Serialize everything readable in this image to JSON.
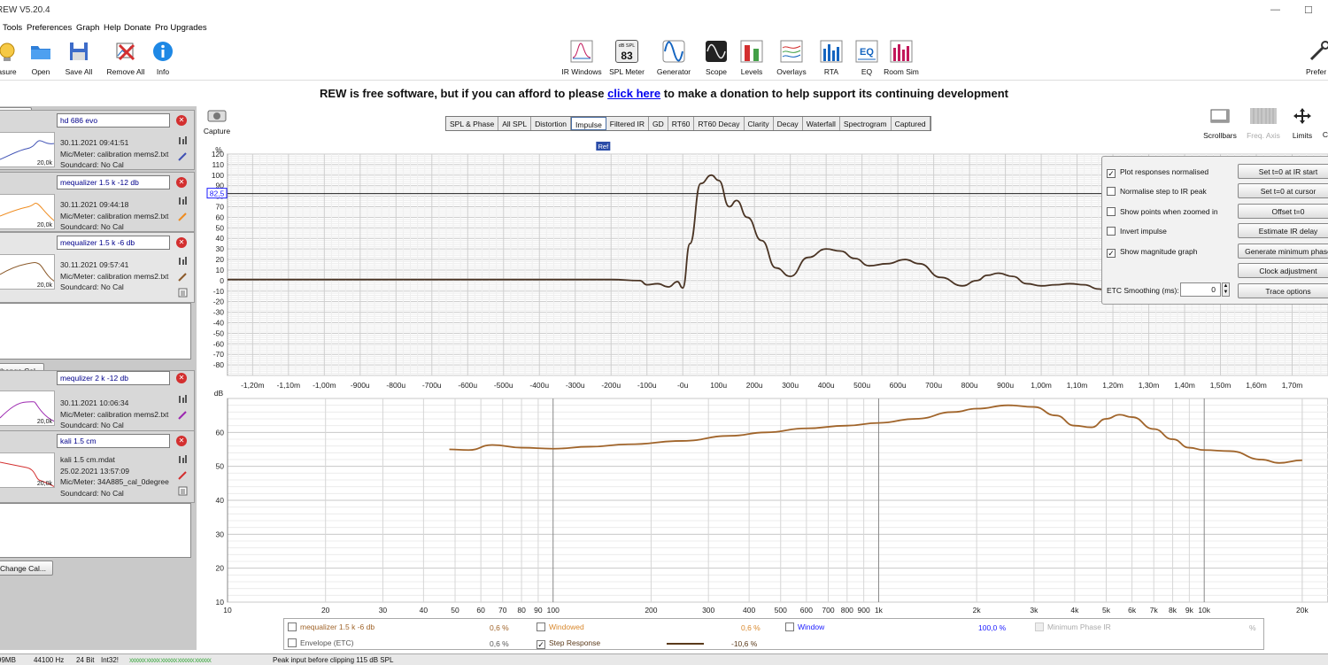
{
  "app": {
    "title": "REW V5.20.4"
  },
  "menu": [
    "Tools",
    "Preferences",
    "Graph",
    "Help",
    "Donate",
    "Pro Upgrades"
  ],
  "toolbar": {
    "left": [
      "asure",
      "Open",
      "Save All",
      "Remove All",
      "Info"
    ],
    "center": [
      "IR Windows",
      "SPL Meter",
      "Generator",
      "Scope",
      "Levels",
      "Overlays",
      "RTA",
      "EQ",
      "Room Sim"
    ],
    "right": "Prefer",
    "spl_meter_top": "dB SPL",
    "spl_meter_value": "83"
  },
  "banner": {
    "before": "REW is free software, but if you can afford to please ",
    "link": "click here",
    "after": " to make a donation to help support its continuing development"
  },
  "panel": {
    "collapse_label": "apse",
    "change_cal_label": "Change Cal..."
  },
  "measurements": [
    {
      "name": "hd 686 evo",
      "date": "30.11.2021 09:41:51",
      "mic": "Mic/Meter: calibration mems2.txt",
      "sound": "Soundcard: No Cal",
      "axis": "20,0k",
      "color": "#3f51b5"
    },
    {
      "name": "mequalizer 1.5 k -12 db",
      "date": "30.11.2021 09:44:18",
      "mic": "Mic/Meter: calibration mems2.txt",
      "sound": "Soundcard: No Cal",
      "axis": "20,0k",
      "color": "#ef8c1f"
    },
    {
      "name": "mequalizer 1.5 k -6 db",
      "date": "30.11.2021 09:57:41",
      "mic": "Mic/Meter: calibration mems2.txt",
      "sound": "Soundcard: No Cal",
      "axis": "20,0k",
      "color": "#8b5a2b"
    },
    {
      "name": "mequlizer 2 k -12 db",
      "date": "30.11.2021 10:06:34",
      "mic": "Mic/Meter: calibration mems2.txt",
      "sound": "Soundcard: No Cal",
      "axis": "20,0k",
      "color": "#9c27b0"
    },
    {
      "name": "kali 1.5 cm",
      "file": "kali 1.5 cm.mdat",
      "date": "25.02.2021 13:57:09",
      "mic": "Mic/Meter: 34A885_cal_0degree",
      "sound": "Soundcard: No Cal",
      "axis": "20,0k",
      "color": "#d32f2f"
    }
  ],
  "capture_label": "Capture",
  "tabs": [
    "SPL & Phase",
    "All SPL",
    "Distortion",
    "Impulse",
    "Filtered IR",
    "GD",
    "RT60",
    "RT60 Decay",
    "Clarity",
    "Decay",
    "Waterfall",
    "Spectrogram",
    "Captured"
  ],
  "active_tab": "Impulse",
  "graph_controls": [
    "Scrollbars",
    "Freq. Axis",
    "Limits",
    "C"
  ],
  "impulse": {
    "unit": "%",
    "ref_label": "Ref",
    "cursor_value": "82,5",
    "y_ticks": [
      "120",
      "110",
      "100",
      "90",
      "80",
      "70",
      "60",
      "50",
      "40",
      "30",
      "20",
      "10",
      "0",
      "-10",
      "-20",
      "-30",
      "-40",
      "-50",
      "-60",
      "-70",
      "-80"
    ],
    "x_ticks": [
      "-1,20m",
      "-1,10m",
      "-1,00m",
      "-900u",
      "-800u",
      "-700u",
      "-600u",
      "-500u",
      "-400u",
      "-300u",
      "-200u",
      "-100u",
      "-0u",
      "100u",
      "200u",
      "300u",
      "400u",
      "500u",
      "600u",
      "700u",
      "800u",
      "900u",
      "1,00m",
      "1,10m",
      "1,20m",
      "1,30m",
      "1,40m",
      "1,50m",
      "1,60m",
      "1,70m"
    ],
    "line_color": "#4a3424"
  },
  "magnitude": {
    "unit": "dB",
    "y_ticks": [
      "60",
      "50",
      "40",
      "30",
      "20",
      "10"
    ],
    "x_ticks": [
      "10",
      "20",
      "30",
      "40",
      "50",
      "60",
      "70",
      "80",
      "90",
      "100",
      "200",
      "300",
      "400",
      "500",
      "600",
      "700",
      "800",
      "900",
      "1k",
      "2k",
      "3k",
      "4k",
      "5k",
      "6k",
      "7k",
      "8k",
      "9k",
      "10k",
      "20k"
    ],
    "line_color": "#a0642a"
  },
  "chart_data": [
    {
      "type": "line",
      "title": "",
      "xlabel": "",
      "ylabel": "%",
      "xlim_ms": [
        -1.27,
        1.8
      ],
      "ylim": [
        -90,
        120
      ],
      "series": [
        {
          "name": "",
          "x": [
            -1.27,
            -0.2,
            -0.12,
            -0.1,
            -0.07,
            -0.04,
            -0.015,
            0.0,
            0.02,
            0.05,
            0.08,
            0.1,
            0.13,
            0.15,
            0.18,
            0.22,
            0.26,
            0.3,
            0.35,
            0.4,
            0.44,
            0.48,
            0.52,
            0.57,
            0.62,
            0.66,
            0.72,
            0.78,
            0.82,
            0.85,
            0.88,
            0.92,
            0.96,
            1.0,
            1.04,
            1.08,
            1.12,
            1.16,
            1.2,
            1.28,
            1.36,
            1.45,
            1.55,
            1.65,
            1.72,
            1.8
          ],
          "y": [
            1,
            1,
            0,
            -4,
            -3,
            -6,
            -1,
            -7,
            35,
            92,
            100,
            95,
            70,
            76,
            60,
            38,
            12,
            4,
            22,
            30,
            28,
            21,
            14,
            16,
            20,
            16,
            3,
            -5,
            0,
            5,
            7,
            4,
            -3,
            -5,
            -4,
            -3,
            -4,
            -8,
            -12,
            -6,
            -4,
            -7,
            -3,
            -2,
            -3,
            -3
          ]
        }
      ]
    },
    {
      "type": "line",
      "title": "",
      "xlabel": "",
      "ylabel": "dB",
      "x_scale": "log",
      "xlim": [
        10,
        20000
      ],
      "ylim": [
        10,
        70
      ],
      "series": [
        {
          "name": "mequalizer 1.5 k -6 db",
          "x": [
            48,
            55,
            65,
            80,
            100,
            130,
            170,
            250,
            350,
            450,
            600,
            800,
            1000,
            1300,
            1700,
            2000,
            2500,
            3000,
            3500,
            4000,
            4500,
            5000,
            5500,
            6000,
            7000,
            8000,
            9000,
            10000,
            12000,
            15000,
            17000,
            20000
          ],
          "y": [
            55,
            54.8,
            56.3,
            55.5,
            55.2,
            55.8,
            56.5,
            57.5,
            59,
            60,
            61.2,
            62,
            62.8,
            64,
            66,
            67,
            68,
            67.5,
            65,
            62,
            61.5,
            64,
            65.2,
            64.5,
            61,
            58,
            55.5,
            54.8,
            54.5,
            52,
            51,
            51.8
          ]
        }
      ]
    }
  ],
  "ctrl_panel": {
    "checks": [
      {
        "label": "Plot responses normalised",
        "checked": true
      },
      {
        "label": "Normalise step to IR peak",
        "checked": false
      },
      {
        "label": "Show points when zoomed in",
        "checked": false
      },
      {
        "label": "Invert impulse",
        "checked": false
      },
      {
        "label": "Show magnitude graph",
        "checked": true
      }
    ],
    "buttons": [
      "Set t=0 at IR start",
      "Set t=0 at cursor",
      "Offset t=0",
      "Estimate IR delay",
      "Generate minimum phase",
      "Clock adjustment",
      "Trace options"
    ],
    "etc_label": "ETC Smoothing (ms):",
    "etc_value": "0"
  },
  "legend": {
    "row1": [
      {
        "label": "mequalizer 1.5 k -6 db",
        "value": "0,6 %",
        "color": "#a0642a"
      },
      {
        "label": "Windowed",
        "value": "0,6 %",
        "color": "#d9882d"
      },
      {
        "label": "Window",
        "value": "100,0 %",
        "color": "#1a1aff"
      },
      {
        "label": "Minimum Phase IR",
        "value": "%",
        "color": "#999999"
      }
    ],
    "row2": [
      {
        "label": "Envelope (ETC)",
        "value": "0,6 %",
        "color": "#555555"
      },
      {
        "label": "Step Response",
        "value": "-10,6 %",
        "color": "#5a3a1a"
      }
    ]
  },
  "status": [
    "99MB",
    "44100 Hz",
    "24 Bit",
    "Int32!",
    "Peak input before clipping 115 dB SPL"
  ]
}
